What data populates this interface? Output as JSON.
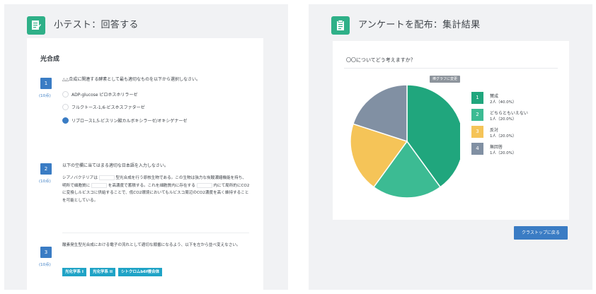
{
  "left": {
    "title": "小テスト：回答する",
    "section_title": "光合成",
    "questions": [
      {
        "number": "1",
        "points": "(10点)",
        "prompt": "△△合成に関連する酵素として最も適切なものを以下から選択しなさい。",
        "options": [
          {
            "label": "ADP-glucose ピロホスホリラーゼ",
            "checked": false
          },
          {
            "label": "フルクトース-1,6-ビスホスファターゼ",
            "checked": false
          },
          {
            "label": "リブロース1,5-ビスリン酸カルボキシラーゼ/オキシゲナーゼ",
            "checked": true
          }
        ]
      },
      {
        "number": "2",
        "points": "(10点)",
        "prompt": "以下の空欄に当てはまる適切な日本語を入力しなさい。",
        "paragraph": {
          "p1": "シアノバクテリアは",
          "p2": "型光合成を行う原核生物である。この生物は強力な炭酸濃縮機能を持ち、明所で細胞質に",
          "p3": "を高濃度で蓄積する。これを細胞質内に存在する",
          "p4": "内にて局所的にCO2に変換しルビスコに供給することで、低CO2環境においてもルビスコ周辺のCO2濃度を高く維持することを可能としている。"
        }
      },
      {
        "number": "3",
        "points": "(10点)",
        "prompt": "酸素発生型光合成における電子の流れとして適切な順番になるよう、以下を左から並べ変えなさい。",
        "chips": [
          "光化学系 I",
          "光化学系 II",
          "シトクロムb6f複合体"
        ]
      }
    ]
  },
  "right": {
    "title": "アンケートを配布：集計結果",
    "question": "〇〇についてどう考えますか？",
    "toggle_label": "棒グラフに変更",
    "back_button": "クラストップに戻る"
  },
  "chart_data": {
    "type": "pie",
    "categories": [
      "賛成",
      "どちらともいえない",
      "反対",
      "無回答"
    ],
    "values": [
      2,
      1,
      1,
      1
    ],
    "legend": [
      {
        "num": "1",
        "name": "賛成",
        "value": "2人（40.0%）",
        "color": "#20a67d"
      },
      {
        "num": "2",
        "name": "どちらともいえない",
        "value": "1人（20.0%）",
        "color": "#3cbb93"
      },
      {
        "num": "3",
        "name": "反対",
        "value": "1人（20.0%）",
        "color": "#f5c458"
      },
      {
        "num": "4",
        "name": "無回答",
        "value": "1人（20.0%）",
        "color": "#8190a3"
      }
    ]
  }
}
